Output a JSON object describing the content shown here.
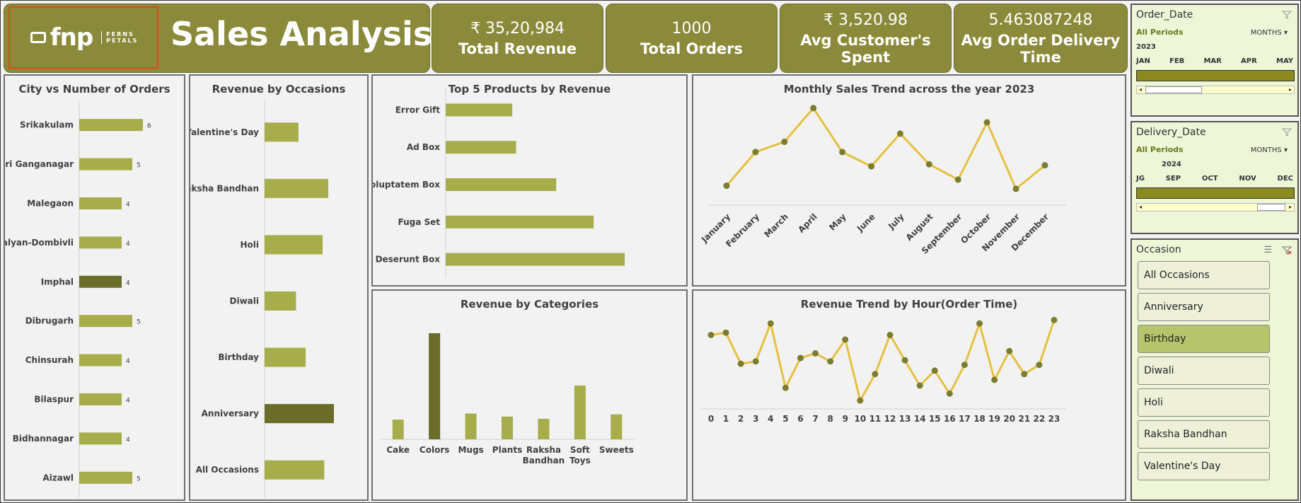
{
  "header": {
    "logo_text": "fnp",
    "logo_sub": "FERNS PETALS",
    "title": "Sales Analysis"
  },
  "kpis": [
    {
      "value": "₹ 35,20,984",
      "label": "Total Revenue"
    },
    {
      "value": "1000",
      "label": "Total Orders"
    },
    {
      "value": "₹ 3,520.98",
      "label": "Avg Customer's Spent"
    },
    {
      "value": "5.463087248",
      "label": "Avg Order Delivery Time"
    }
  ],
  "colors": {
    "accent": "#8a8a3a",
    "bar": "#a6ad4a",
    "bar_dark": "#6b6b2a",
    "line": "#e6c040",
    "dot": "#7a7d2e"
  },
  "chart_data": [
    {
      "type": "bar",
      "title": "City vs Number of Orders",
      "categories": [
        "Srikakulam",
        "Sri Ganganagar",
        "Malegaon",
        "Kalyan-Dombivli",
        "Imphal",
        "Dibrugarh",
        "Chinsurah",
        "Bilaspur",
        "Bidhannagar",
        "Aizawl"
      ],
      "values": [
        6,
        5,
        4,
        4,
        4,
        5,
        4,
        4,
        4,
        5
      ],
      "highlight": "Imphal"
    },
    {
      "type": "bar",
      "title": "Revenue by Occasions",
      "categories": [
        "Valentine's Day",
        "Raksha Bandhan",
        "Holi",
        "Diwali",
        "Birthday",
        "Anniversary",
        "All Occasions"
      ],
      "values": [
        420000,
        790000,
        720000,
        390000,
        510000,
        860000,
        740000
      ],
      "highlight": "Anniversary"
    },
    {
      "type": "bar",
      "title": "Top 5 Products by Revenue",
      "categories": [
        "Error Gift",
        "Ad Box",
        "Voluptatem Box",
        "Fuga Set",
        "Deserunt Box"
      ],
      "values": [
        103000,
        109000,
        171000,
        229000,
        277000
      ]
    },
    {
      "type": "line",
      "title": "Monthly Sales Trend across the year 2023",
      "categories": [
        "January",
        "February",
        "March",
        "April",
        "May",
        "June",
        "July",
        "August",
        "September",
        "October",
        "November",
        "December"
      ],
      "values": [
        290000,
        323000,
        333000,
        366000,
        323000,
        309000,
        341000,
        311000,
        296000,
        352000,
        287000,
        310000
      ]
    },
    {
      "type": "bar",
      "title": "Revenue by Categories",
      "categories": [
        "Cake",
        "Colors",
        "Mugs",
        "Plants",
        "Raksha Bandhan",
        "Soft Toys",
        "Sweets"
      ],
      "values": [
        260000,
        1400000,
        340000,
        300000,
        270000,
        710000,
        330000
      ],
      "highlight": "Colors"
    },
    {
      "type": "line",
      "title": "Revenue Trend by Hour(Order Time)",
      "categories": [
        "0",
        "1",
        "2",
        "3",
        "4",
        "5",
        "6",
        "7",
        "8",
        "9",
        "10",
        "11",
        "12",
        "13",
        "14",
        "15",
        "16",
        "17",
        "18",
        "19",
        "20",
        "21",
        "22",
        "23"
      ],
      "values": [
        150000,
        152000,
        125000,
        127000,
        160000,
        104000,
        130000,
        134000,
        127000,
        146000,
        93000,
        116000,
        150000,
        128000,
        106000,
        119000,
        99000,
        124000,
        160000,
        111000,
        136000,
        116000,
        124000,
        163000
      ]
    }
  ],
  "slicers": {
    "order_date": {
      "title": "Order_Date",
      "all_periods": "All Periods",
      "level": "MONTHS",
      "year": "2023",
      "months": [
        "JAN",
        "FEB",
        "MAR",
        "APR",
        "MAY"
      ]
    },
    "delivery_date": {
      "title": "Delivery_Date",
      "all_periods": "All Periods",
      "level": "MONTHS",
      "year": "2024",
      "months": [
        "JG",
        "SEP",
        "OCT",
        "NOV",
        "DEC"
      ]
    },
    "occasion": {
      "title": "Occasion",
      "items": [
        "All Occasions",
        "Anniversary",
        "Birthday",
        "Diwali",
        "Holi",
        "Raksha Bandhan",
        "Valentine's Day"
      ],
      "selected": "Birthday"
    }
  }
}
